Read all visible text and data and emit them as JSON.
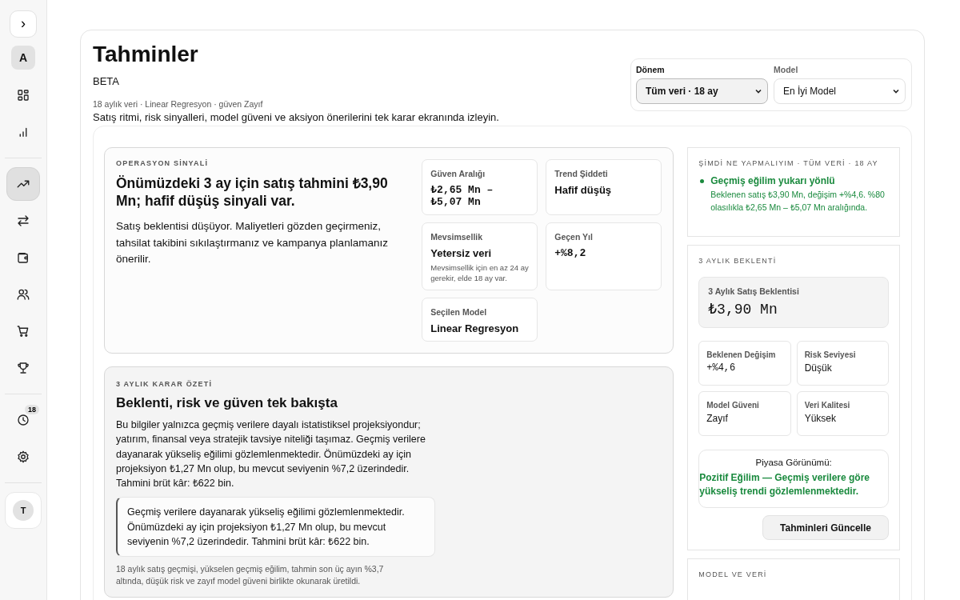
{
  "sidebar": {
    "toggle": "›",
    "workspace_avatar": "A",
    "nav_groups": [
      [
        {
          "kind": "grid",
          "selected": false
        },
        {
          "kind": "bars",
          "selected": false
        }
      ],
      [
        {
          "kind": "trend",
          "selected": true
        },
        {
          "kind": "transfer",
          "selected": false
        },
        {
          "kind": "wallet",
          "selected": false
        },
        {
          "kind": "users",
          "selected": false
        },
        {
          "kind": "cart",
          "selected": false
        },
        {
          "kind": "trophy",
          "selected": false
        }
      ],
      [
        {
          "kind": "clock",
          "selected": false,
          "badge": "18"
        },
        {
          "kind": "gear",
          "selected": false
        }
      ]
    ],
    "user_avatar": "T"
  },
  "header": {
    "title": "Tahminler",
    "badge": "BETA",
    "meta": "18 aylık veri · Linear Regresyon · güven Zayıf",
    "description": "Satış ritmi, risk sinyalleri, model güveni ve aksiyon önerilerini tek karar ekranında izleyin."
  },
  "filters": [
    {
      "label": "Dönem",
      "value": "Tüm veri · 18 ay",
      "active": true
    },
    {
      "label": "Model",
      "value": "En İyi Model",
      "active": false
    }
  ],
  "signal": {
    "eyebrow": "OPERASYON SİNYALİ",
    "headline": "Önümüzdeki 3 ay için satış tahmini ₺3,90 Mn; hafif düşüş sinyali var.",
    "body": "Satış beklentisi düşüyor. Maliyetleri gözden geçirmeniz, tahsilat takibini sıkılaştırmanız ve kampanya planlamanız önerilir.",
    "metrics": [
      {
        "label": "Güven Aralığı",
        "value": "₺2,65 Mn – ₺5,07 Mn",
        "kind": "number"
      },
      {
        "label": "Trend Şiddeti",
        "value": "Hafif düşüş",
        "kind": "text"
      },
      {
        "label": "Mevsimsellik",
        "value": "Yetersiz veri",
        "note": "Mevsimsellik için en az 24 ay gerekir, elde 18 ay var.",
        "kind": "text"
      },
      {
        "label": "Geçen Yıl",
        "value": "+%8,2",
        "kind": "number"
      },
      {
        "label": "Seçilen Model",
        "value": "Linear Regresyon",
        "kind": "text"
      }
    ]
  },
  "summary": {
    "eyebrow": "3 AYLIK KARAR ÖZETİ",
    "title": "Beklenti, risk ve güven tek bakışta",
    "body": "Bu bilgiler yalnızca geçmiş verilere dayalı istatistiksel projeksiyondur; yatırım, finansal veya stratejik tavsiye niteliği taşımaz. Geçmiş verilere dayanarak yükseliş eğilimi gözlemlenmektedir. Önümüzdeki ay için projeksiyon ₺1,27 Mn olup, bu mevcut seviyenin %7,2 üzerindedir. Tahmini brüt kâr: ₺622 bin.",
    "quote": "Geçmiş verilere dayanarak yükseliş eğilimi gözlemlenmektedir. Önümüzdeki ay için projeksiyon ₺1,27 Mn olup, bu mevcut seviyenin %7,2 üzerindedir. Tahmini brüt kâr: ₺622 bin.",
    "footnote": "18 aylık satış geçmişi, yükselen geçmiş eğilim, tahmin son üç ayın %3,7 altında, düşük risk ve zayıf model güveni birlikte okunarak üretildi."
  },
  "actions": {
    "eyebrow": "ŞİMDİ NE YAPMALIYIM · TÜM VERİ · 18 AY",
    "items": [
      {
        "title": "Geçmiş eğilim yukarı yönlü",
        "text": "Beklenen satış ₺3,90 Mn, değişim +%4,6. %80 olasılıkla ₺2,65 Mn – ₺5,07 Mn aralığında.",
        "color": "#1a8a3e"
      }
    ]
  },
  "outlook": {
    "eyebrow": "3 AYLIK BEKLENTİ",
    "hero": {
      "label": "3 Aylık Satış Beklentisi",
      "value": "₺3,90 Mn"
    },
    "metrics": [
      {
        "label": "Beklenen Değişim",
        "value": "+%4,6",
        "kind": "number"
      },
      {
        "label": "Risk Seviyesi",
        "value": "Düşük",
        "kind": "text"
      },
      {
        "label": "Model Güveni",
        "value": "Zayıf",
        "kind": "text"
      },
      {
        "label": "Veri Kalitesi",
        "value": "Yüksek",
        "kind": "text"
      }
    ],
    "market": {
      "label": "Piyasa Görünümü:",
      "text": "Pozitif Eğilim — Geçmiş verilere göre yükseliş trendi gözlemlenmektedir."
    },
    "button": "Tahminleri Güncelle"
  },
  "model_data": {
    "eyebrow": "MODEL VE VERİ"
  }
}
